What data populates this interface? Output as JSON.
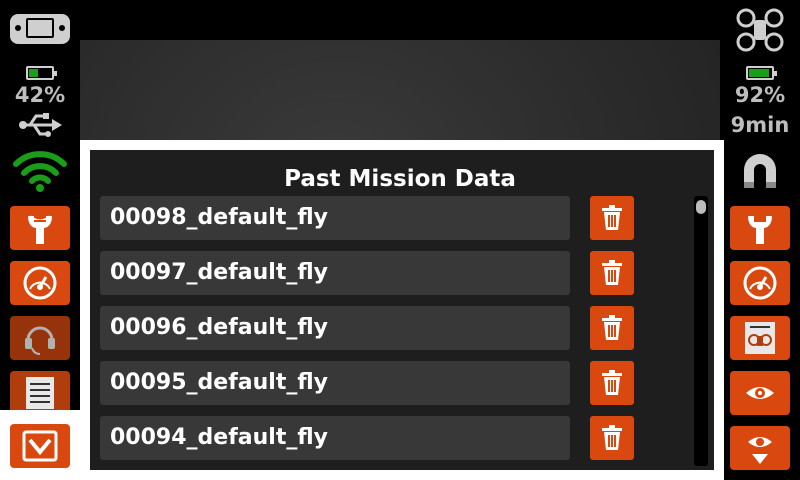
{
  "status": {
    "controller_battery_percent": "42%",
    "controller_battery_level": 0.42,
    "drone_battery_percent": "92%",
    "drone_battery_level": 0.92,
    "flight_time": "9min"
  },
  "dialog": {
    "title": "Past Mission Data",
    "missions": [
      {
        "name": "00098_default_fly"
      },
      {
        "name": "00097_default_fly"
      },
      {
        "name": "00096_default_fly"
      },
      {
        "name": "00095_default_fly"
      },
      {
        "name": "00094_default_fly"
      }
    ]
  },
  "colors": {
    "accent": "#d9480f",
    "accent_dim": "#b23d0c",
    "row_bg": "#383838",
    "panel_bg": "#1e1e1e",
    "signal_green": "#1a9e1a"
  },
  "icons": {
    "left_sidebar": [
      "gamepad-icon",
      "usb-icon",
      "wifi-icon",
      "wrench-icon",
      "gauge-icon",
      "headset-icon",
      "document-icon",
      "chevron-down-icon"
    ],
    "right_sidebar": [
      "drone-icon",
      "magnet-icon",
      "wrench-icon",
      "gauge-icon",
      "drone-settings-icon",
      "eye-arrows-icon",
      "eye-down-icon"
    ],
    "row_action": "trash-icon"
  }
}
